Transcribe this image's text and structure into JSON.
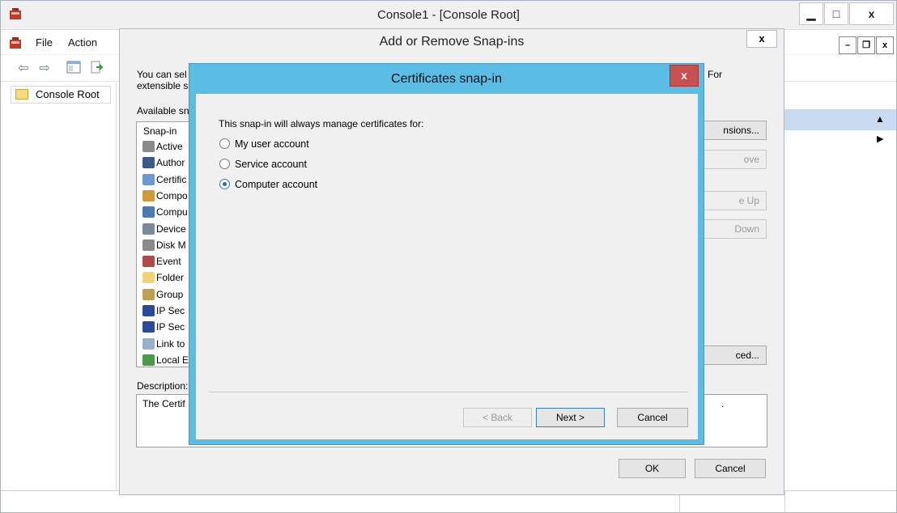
{
  "console": {
    "title": "Console1 - [Console Root]",
    "caption_buttons": {
      "minimize": "▁",
      "maximize": "□",
      "close": "x"
    },
    "menu": {
      "file": "File",
      "action": "Action"
    },
    "mdi_buttons": {
      "minimize": "–",
      "restore": "❐",
      "close": "x"
    },
    "toolbar_icons": [
      "back-arrow-icon",
      "forward-arrow-icon",
      "show-hide-tree-icon",
      "export-list-icon"
    ],
    "tree": {
      "root_label": "Console Root"
    },
    "actions": {
      "collapse_glyph": "▲",
      "more_glyph": "▶"
    }
  },
  "snapins_dialog": {
    "title": "Add or Remove Snap-ins",
    "close_glyph": "x",
    "intro_line1": "You can sel",
    "intro_line2": "extensible s",
    "intro_right": "For",
    "available_label": "Available sn",
    "list_header": "Snap-in",
    "snapins": [
      {
        "label": "Active",
        "icon": "active-directory-icon",
        "color": "#8a8a8a"
      },
      {
        "label": "Author",
        "icon": "authorization-manager-icon",
        "color": "#3a5a8a"
      },
      {
        "label": "Certific",
        "icon": "certificates-icon",
        "color": "#6a9ad0"
      },
      {
        "label": "Compo",
        "icon": "component-services-icon",
        "color": "#d09a3a"
      },
      {
        "label": "Compu",
        "icon": "computer-management-icon",
        "color": "#4a7ab0"
      },
      {
        "label": "Device",
        "icon": "device-manager-icon",
        "color": "#7a8a9a"
      },
      {
        "label": "Disk M",
        "icon": "disk-management-icon",
        "color": "#8a8a8a"
      },
      {
        "label": "Event",
        "icon": "event-viewer-icon",
        "color": "#b04a4a"
      },
      {
        "label": "Folder",
        "icon": "folder-icon",
        "color": "#f2d27a"
      },
      {
        "label": "Group",
        "icon": "group-policy-icon",
        "color": "#c0a050"
      },
      {
        "label": "IP Sec",
        "icon": "ip-security-icon",
        "color": "#2a4a9a"
      },
      {
        "label": "IP Sec",
        "icon": "ip-security-icon",
        "color": "#2a4a9a"
      },
      {
        "label": "Link to",
        "icon": "link-icon",
        "color": "#9ab0c8"
      },
      {
        "label": "Local E",
        "icon": "local-users-icon",
        "color": "#4a9a4a"
      }
    ],
    "buttons": {
      "extensions": "nsions...",
      "remove": "ove",
      "move_up": "e Up",
      "move_down": "Down",
      "advanced": "ced...",
      "ok": "OK",
      "cancel": "Cancel"
    },
    "description_label": "Description:",
    "description_text": "The Certif",
    "description_tail": "."
  },
  "cert_dialog": {
    "title": "Certificates snap-in",
    "close_glyph": "x",
    "prompt": "This snap-in will always manage certificates for:",
    "options": [
      {
        "label": "My user account",
        "checked": false
      },
      {
        "label": "Service account",
        "checked": false
      },
      {
        "label": "Computer account",
        "checked": true
      }
    ],
    "buttons": {
      "back": "< Back",
      "next": "Next >",
      "cancel": "Cancel"
    }
  }
}
